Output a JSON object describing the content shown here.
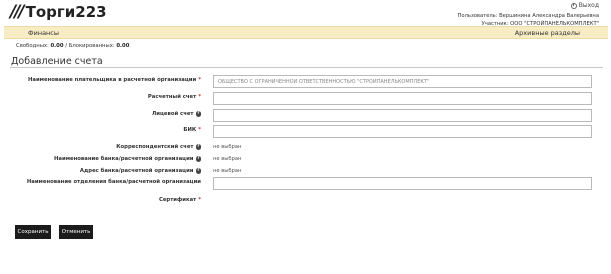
{
  "logo": {
    "mark": "///",
    "text": "Торги223"
  },
  "header": {
    "logout_label": "Выход",
    "user_line": "Пользователь: Вершинина Александра Валерьевна",
    "participant_line": "Участник: ООО \"СТРОЙПАНЕЛЬКОМПЛЕКТ\""
  },
  "nav": {
    "finance": "Финансы",
    "archive": "Архивные разделы"
  },
  "balance": {
    "free_label": "Свободных:",
    "free_value": "0.00",
    "separator": " / ",
    "blocked_label": "Блокированных:",
    "blocked_value": "0.00"
  },
  "page": {
    "title": "Добавление счета"
  },
  "form": {
    "payer_name": {
      "label": "Наименование плательщика в расчетной организации",
      "required": "*",
      "value": "ОБЩЕСТВО С ОГРАНИЧЕННОЙ ОТВЕТСТВЕННОСТЬЮ \"СТРОЙПАНЕЛЬКОМПЛЕКТ\""
    },
    "settlement_account": {
      "label": "Расчетный счет",
      "required": "*",
      "value": ""
    },
    "personal_account": {
      "label": "Лицевой счет",
      "help": "?",
      "value": ""
    },
    "bik": {
      "label": "БИК",
      "required": "*",
      "value": ""
    },
    "corr_account": {
      "label": "Корреспондентский счет",
      "help": "?",
      "value": "не выбран"
    },
    "bank_name": {
      "label": "Наименование банка/расчетной организации",
      "help": "?",
      "value": "не выбран"
    },
    "bank_address": {
      "label": "Адрес банка/расчетной организации",
      "help": "?",
      "value": "не выбран"
    },
    "branch_name": {
      "label": "Наименование отделения банка/расчетной организации",
      "value": ""
    },
    "certificate": {
      "label": "Сертификат",
      "required": "*"
    }
  },
  "buttons": {
    "save": "Сохранить",
    "cancel": "Отменить"
  }
}
